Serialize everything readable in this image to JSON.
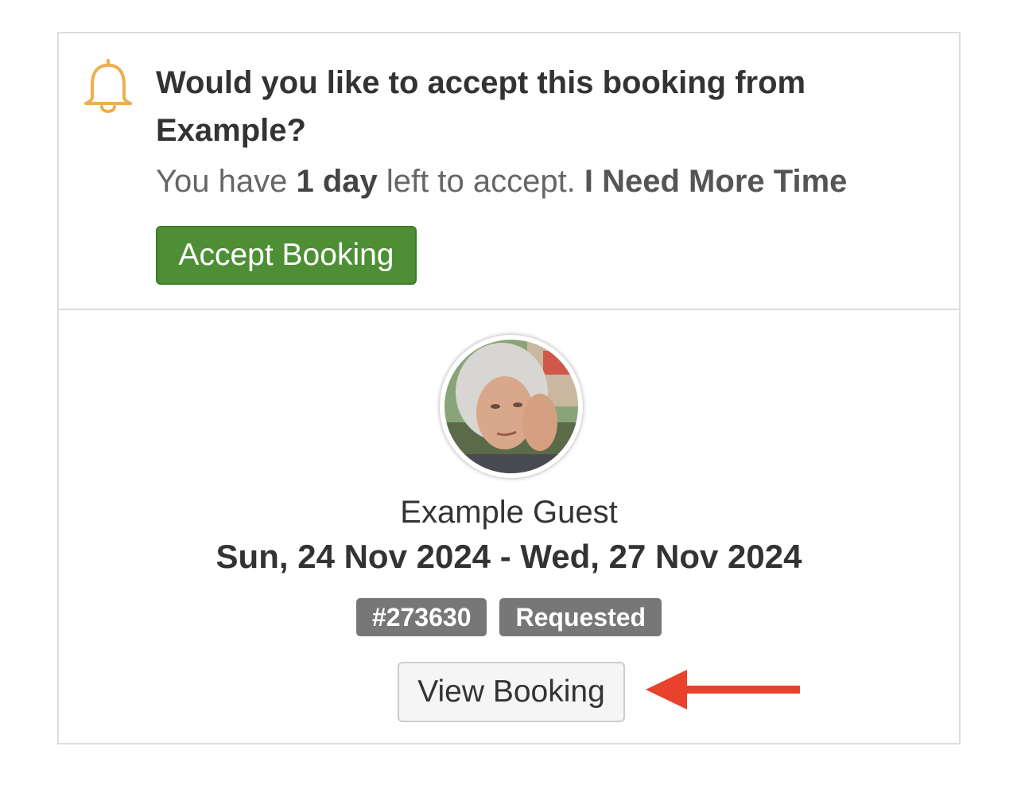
{
  "notice": {
    "icon": "bell-icon",
    "icon_color": "#f0ad4e",
    "question": "Would you like to accept this booking from Example?",
    "deadline_prefix": "You have ",
    "deadline_amount": "1 day",
    "deadline_suffix": " left to accept. ",
    "more_time_link": "I Need More Time",
    "accept_button": "Accept Booking",
    "accept_color": "#4e8f35"
  },
  "guest": {
    "avatar": "guest-avatar",
    "name": "Example Guest",
    "dates": "Sun, 24 Nov 2024 - Wed, 27 Nov 2024",
    "booking_id": "#273630",
    "status": "Requested",
    "view_button": "View Booking"
  },
  "annotation": {
    "arrow_icon": "left-arrow-icon",
    "arrow_color": "#e8412c"
  }
}
